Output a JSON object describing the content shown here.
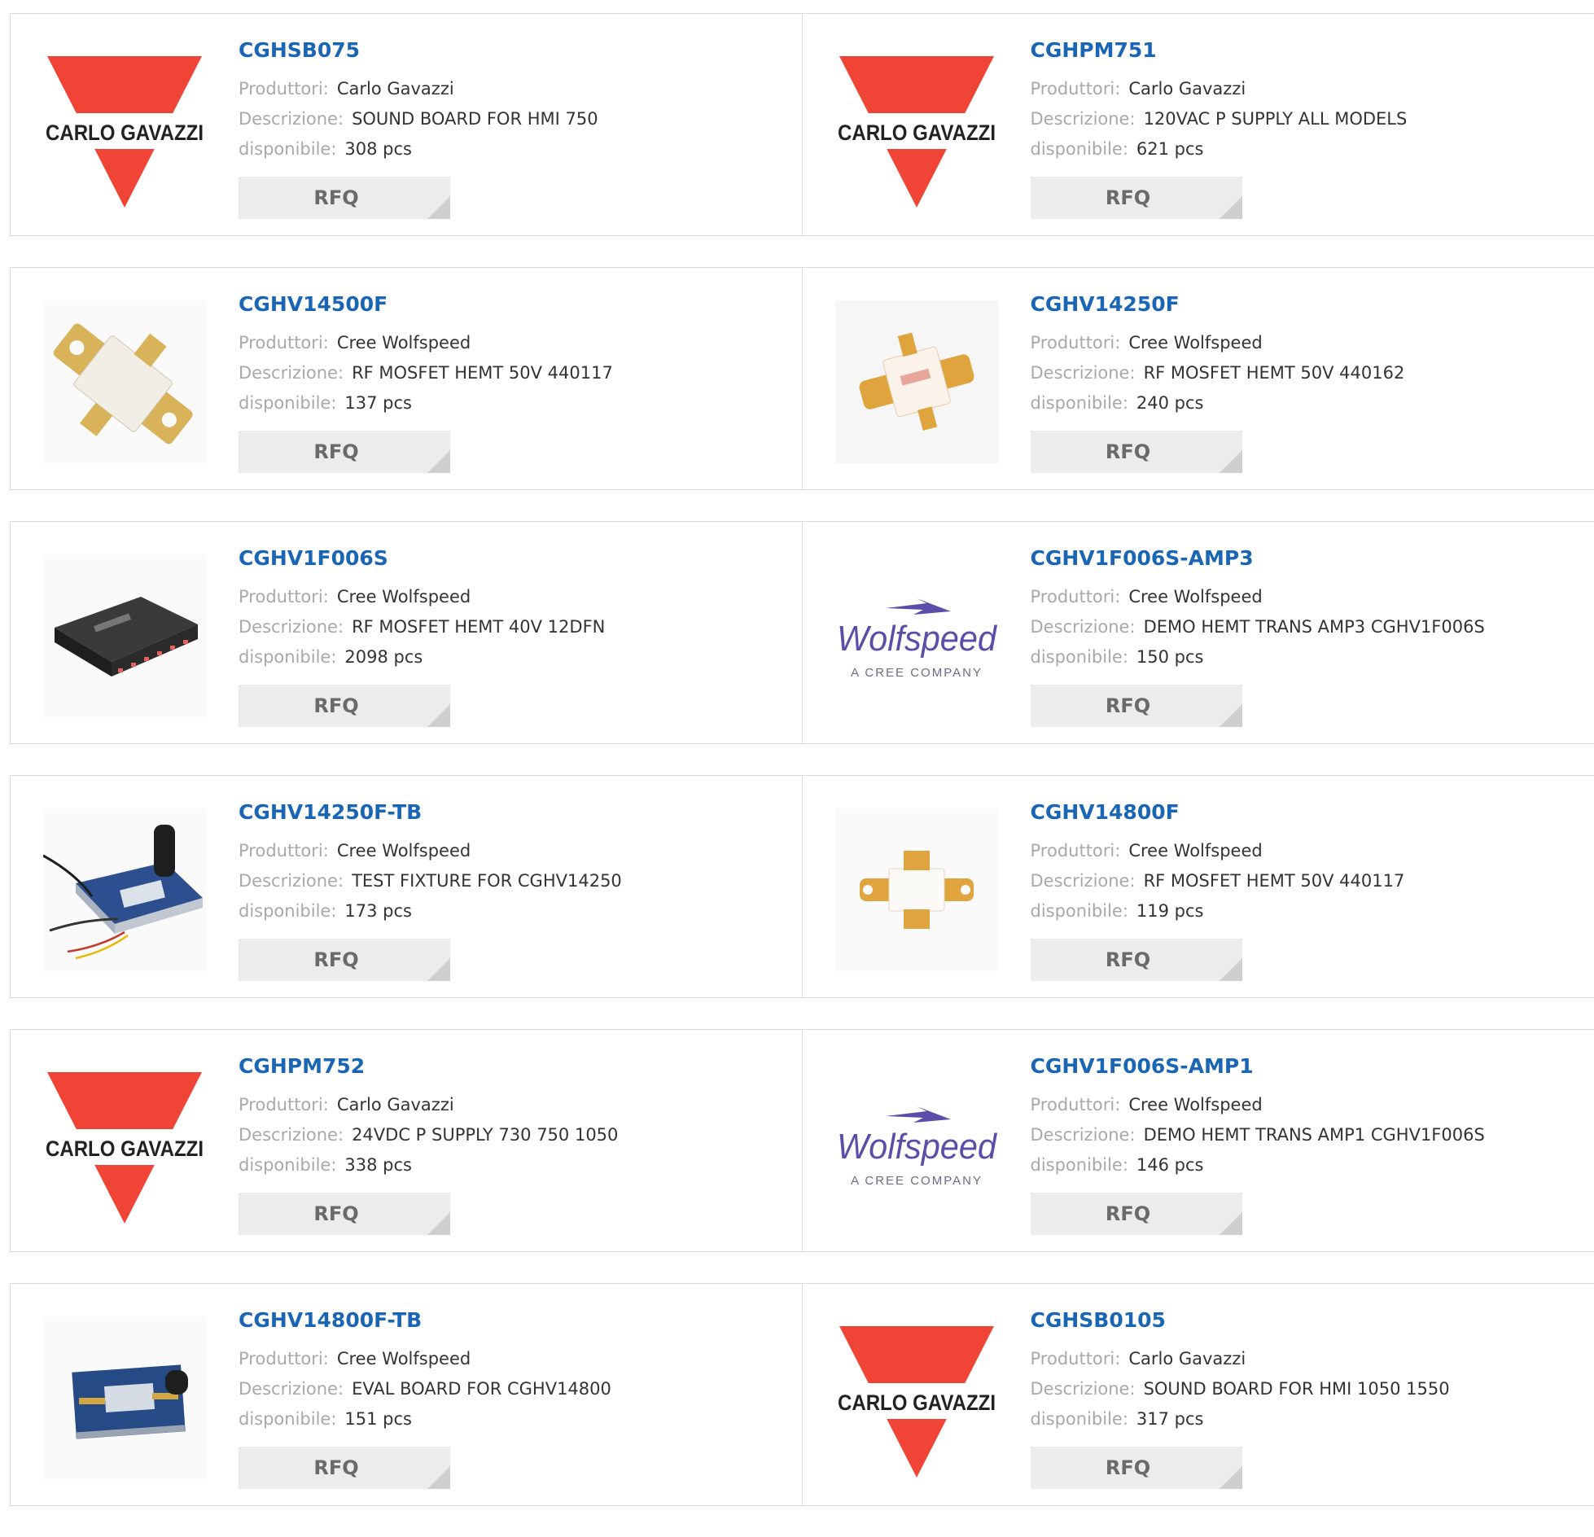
{
  "labels": {
    "manufacturer": "Produttori:",
    "description": "Descrizione:",
    "available": "disponibile:",
    "rfq": "RFQ"
  },
  "brand_colors": {
    "carlo_gavazzi_red": "#ef4436",
    "part_number_blue": "#1b66b4",
    "wolfspeed_purple": "#5b4ea8"
  },
  "products": [
    {
      "part": "CGHSB075",
      "manufacturer": "Carlo Gavazzi",
      "description": "SOUND BOARD FOR HMI 750",
      "available": "308 pcs",
      "image": "carlo-gavazzi-logo",
      "logo_text": "CARLO GAVAZZI"
    },
    {
      "part": "CGHPM751",
      "manufacturer": "Carlo Gavazzi",
      "description": "120VAC P SUPPLY ALL MODELS",
      "available": "621 pcs",
      "image": "carlo-gavazzi-logo",
      "logo_text": "CARLO GAVAZZI"
    },
    {
      "part": "CGHV14500F",
      "manufacturer": "Cree Wolfspeed",
      "description": "RF MOSFET HEMT 50V 440117",
      "available": "137 pcs",
      "image": "flange-transistor-photo"
    },
    {
      "part": "CGHV14250F",
      "manufacturer": "Cree Wolfspeed",
      "description": "RF MOSFET HEMT 50V 440162",
      "available": "240 pcs",
      "image": "small-flange-transistor-photo"
    },
    {
      "part": "CGHV1F006S",
      "manufacturer": "Cree Wolfspeed",
      "description": "RF MOSFET HEMT 40V 12DFN",
      "available": "2098 pcs",
      "image": "dfn-chip-photo"
    },
    {
      "part": "CGHV1F006S-AMP3",
      "manufacturer": "Cree Wolfspeed",
      "description": "DEMO HEMT TRANS AMP3 CGHV1F006S",
      "available": "150 pcs",
      "image": "wolfspeed-logo",
      "logo_text": "Wolfspeed",
      "logo_subtext": "A CREE COMPANY"
    },
    {
      "part": "CGHV14250F-TB",
      "manufacturer": "Cree Wolfspeed",
      "description": "TEST FIXTURE FOR CGHV14250",
      "available": "173 pcs",
      "image": "test-fixture-photo"
    },
    {
      "part": "CGHV14800F",
      "manufacturer": "Cree Wolfspeed",
      "description": "RF MOSFET HEMT 50V 440117",
      "available": "119 pcs",
      "image": "flange-transistor-photo-small"
    },
    {
      "part": "CGHPM752",
      "manufacturer": "Carlo Gavazzi",
      "description": "24VDC P SUPPLY 730 750 1050",
      "available": "338 pcs",
      "image": "carlo-gavazzi-logo",
      "logo_text": "CARLO GAVAZZI"
    },
    {
      "part": "CGHV1F006S-AMP1",
      "manufacturer": "Cree Wolfspeed",
      "description": "DEMO HEMT TRANS AMP1 CGHV1F006S",
      "available": "146 pcs",
      "image": "wolfspeed-logo",
      "logo_text": "Wolfspeed",
      "logo_subtext": "A CREE COMPANY"
    },
    {
      "part": "CGHV14800F-TB",
      "manufacturer": "Cree Wolfspeed",
      "description": "EVAL BOARD FOR CGHV14800",
      "available": "151 pcs",
      "image": "eval-board-photo"
    },
    {
      "part": "CGHSB0105",
      "manufacturer": "Carlo Gavazzi",
      "description": "SOUND BOARD FOR HMI 1050 1550",
      "available": "317 pcs",
      "image": "carlo-gavazzi-logo",
      "logo_text": "CARLO GAVAZZI"
    }
  ]
}
